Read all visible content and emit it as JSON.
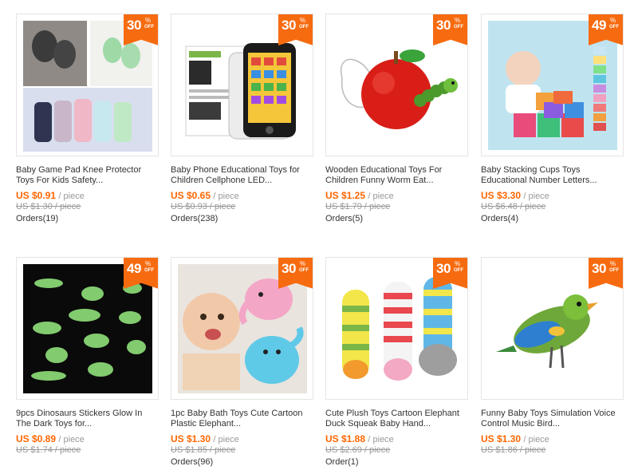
{
  "products": [
    {
      "discount": "30",
      "percent_sign": "%",
      "off_label": "OFF",
      "title_line1": "Baby Game Pad Knee Protector",
      "title_line2": "Toys For Kids Safety...",
      "price": "US $0.91",
      "unit": "/ piece",
      "old_price": "US $1.30 / piece",
      "orders": "Orders(19)"
    },
    {
      "discount": "30",
      "percent_sign": "%",
      "off_label": "OFF",
      "title_line1": "Baby Phone Educational Toys for",
      "title_line2": "Children Cellphone LED...",
      "price": "US $0.65",
      "unit": "/ piece",
      "old_price": "US $0.93 / piece",
      "orders": "Orders(238)"
    },
    {
      "discount": "30",
      "percent_sign": "%",
      "off_label": "OFF",
      "title_line1": "Wooden Educational Toys For",
      "title_line2": "Children Funny Worm Eat...",
      "price": "US $1.25",
      "unit": "/ piece",
      "old_price": "US $1.79 / piece",
      "orders": "Orders(5)"
    },
    {
      "discount": "49",
      "percent_sign": "%",
      "off_label": "OFF",
      "title_line1": "Baby Stacking Cups Toys",
      "title_line2": "Educational Number Letters...",
      "price": "US $3.30",
      "unit": "/ piece",
      "old_price": "US $6.48 / piece",
      "orders": "Orders(4)"
    },
    {
      "discount": "49",
      "percent_sign": "%",
      "off_label": "OFF",
      "title_line1": "9pcs Dinosaurs Stickers Glow In",
      "title_line2": "The Dark Toys for...",
      "price": "US $0.89",
      "unit": "/ piece",
      "old_price": "US $1.74 / piece",
      "orders": ""
    },
    {
      "discount": "30",
      "percent_sign": "%",
      "off_label": "OFF",
      "title_line1": "1pc Baby Bath Toys Cute Cartoon",
      "title_line2": "Plastic Elephant...",
      "price": "US $1.30",
      "unit": "/ piece",
      "old_price": "US $1.85 / piece",
      "orders": "Orders(96)"
    },
    {
      "discount": "30",
      "percent_sign": "%",
      "off_label": "OFF",
      "title_line1": "Cute Plush Toys Cartoon Elephant",
      "title_line2": "Duck Squeak Baby Hand...",
      "price": "US $1.88",
      "unit": "/ piece",
      "old_price": "US $2.69 / piece",
      "orders": "Order(1)"
    },
    {
      "discount": "30",
      "percent_sign": "%",
      "off_label": "OFF",
      "title_line1": "Funny Baby Toys Simulation Voice",
      "title_line2": "Control Music Bird...",
      "price": "US $1.30",
      "unit": "/ piece",
      "old_price": "US $1.86 / piece",
      "orders": ""
    }
  ],
  "colors": {
    "badge": "#f76b10",
    "price": "#ff6600",
    "muted": "#999999"
  }
}
